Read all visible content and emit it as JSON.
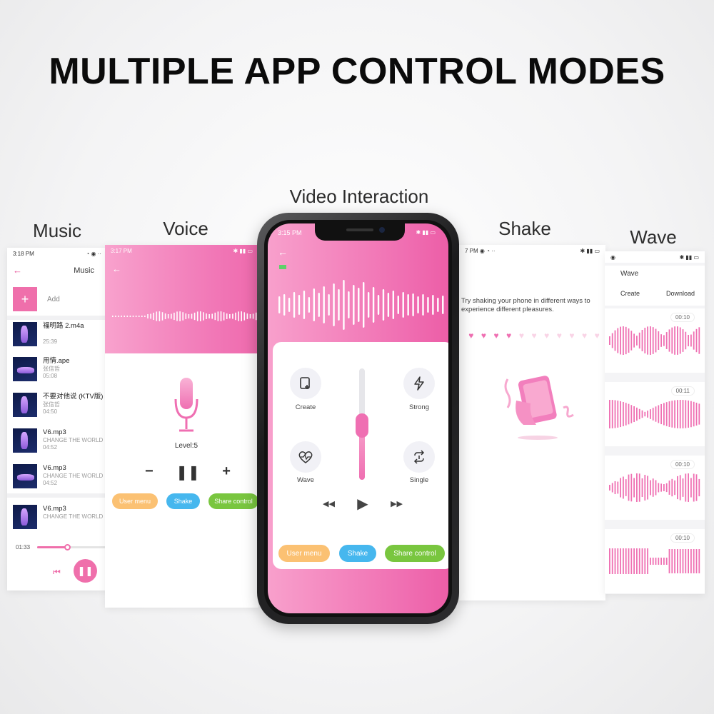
{
  "headline": "MULTIPLE APP CONTROL MODES",
  "modes": {
    "music": "Music",
    "voice": "Voice",
    "video": "Video Interaction",
    "shake": "Shake",
    "wave": "Wave"
  },
  "music_screen": {
    "status_time": "3:18 PM",
    "title": "Music",
    "add_label": "Add",
    "songs": [
      {
        "title": "福明路 2.m4a",
        "artist": "",
        "duration": "25:39"
      },
      {
        "title": "用情.ape",
        "artist": "张信哲",
        "duration": "05:08"
      },
      {
        "title": "不要对他说 (KTV版)",
        "artist": "张信哲",
        "duration": "04:50"
      },
      {
        "title": "V6.mp3",
        "artist": "CHANGE THE WORLD",
        "duration": "04:52"
      },
      {
        "title": "V6.mp3",
        "artist": "CHANGE THE WORLD",
        "duration": "04:52"
      }
    ],
    "now_playing": {
      "title": "V6.mp3",
      "artist": "CHANGE THE WORLD"
    },
    "elapsed": "01:33",
    "progress": 0.42
  },
  "voice_screen": {
    "status_time": "3:17 PM",
    "level_label": "Level:5",
    "buttons": {
      "user_menu": "User menu",
      "shake": "Shake",
      "share": "Share control"
    }
  },
  "video_screen": {
    "status_time": "3:15 PM",
    "modes": {
      "create": "Create",
      "strong": "Strong",
      "wave": "Wave",
      "single": "Single"
    },
    "slider_level": 0.38,
    "buttons": {
      "user_menu": "User menu",
      "shake": "Shake",
      "share": "Share control"
    }
  },
  "shake_screen": {
    "hint": "Try shaking your phone in different ways to experience different pleasures.",
    "hearts_filled": 4,
    "hearts_total": 11
  },
  "wave_screen": {
    "title": "Wave",
    "tabs": [
      "Create",
      "Download"
    ],
    "patterns": [
      {
        "time": "00:10"
      },
      {
        "time": "00:11"
      },
      {
        "time": "00:10"
      },
      {
        "time": "00:10"
      }
    ]
  },
  "colors": {
    "pink": "#ef6fb2",
    "orange": "#fbc173",
    "blue": "#46b7ee",
    "green": "#79c63f"
  }
}
